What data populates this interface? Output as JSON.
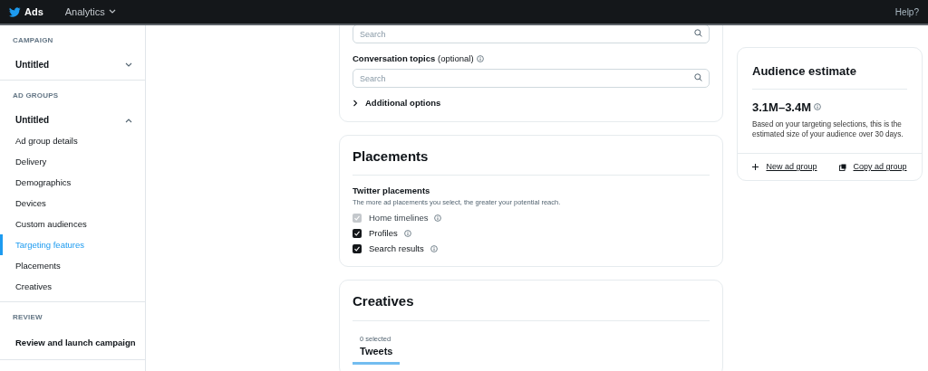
{
  "topbar": {
    "brand": "Ads",
    "menu": "Analytics",
    "help": "Help?"
  },
  "sidebar": {
    "sections": [
      {
        "header": "CAMPAIGN",
        "items": [
          {
            "label": "Untitled",
            "kind": "group",
            "expanded": false
          }
        ]
      },
      {
        "header": "AD GROUPS",
        "items": [
          {
            "label": "Untitled",
            "kind": "group",
            "expanded": true
          },
          {
            "label": "Ad group details",
            "kind": "link",
            "selected": false
          },
          {
            "label": "Delivery",
            "kind": "link",
            "selected": false
          },
          {
            "label": "Demographics",
            "kind": "link",
            "selected": false
          },
          {
            "label": "Devices",
            "kind": "link",
            "selected": false
          },
          {
            "label": "Custom audiences",
            "kind": "link",
            "selected": false
          },
          {
            "label": "Targeting features",
            "kind": "link",
            "selected": true
          },
          {
            "label": "Placements",
            "kind": "link",
            "selected": false
          },
          {
            "label": "Creatives",
            "kind": "link",
            "selected": false
          }
        ]
      },
      {
        "header": "REVIEW",
        "items": [
          {
            "label": "Review and launch campaign",
            "kind": "action"
          }
        ]
      }
    ]
  },
  "targeting": {
    "fields": [
      {
        "placeholder": "Search"
      },
      {
        "label": "**Conversation topics** (optional)",
        "placeholder": "Search"
      }
    ],
    "additional_options": {
      "label": "Additional options",
      "expanded": false
    }
  },
  "placements": {
    "title": "Placements",
    "subtitle": "Twitter placements",
    "hint": "The more ad placements you select, the greater your potential reach.",
    "options": [
      {
        "label": "Home timelines",
        "checked": true,
        "disabled": true
      },
      {
        "label": "Profiles",
        "checked": true,
        "disabled": false
      },
      {
        "label": "Search results",
        "checked": true,
        "disabled": false
      }
    ]
  },
  "creatives": {
    "title": "Creatives",
    "tabs": [
      {
        "count": "0 selected",
        "label": "Tweets",
        "selected": true
      }
    ]
  },
  "audience": {
    "title": "Audience estimate",
    "range": "3.1M–3.4M",
    "description": "Based on your targeting selections, this is the estimated size of your audience over 30 days.",
    "actions": [
      {
        "kind": "new",
        "label": "New ad group"
      },
      {
        "kind": "copy",
        "label": "Copy ad group"
      }
    ]
  }
}
